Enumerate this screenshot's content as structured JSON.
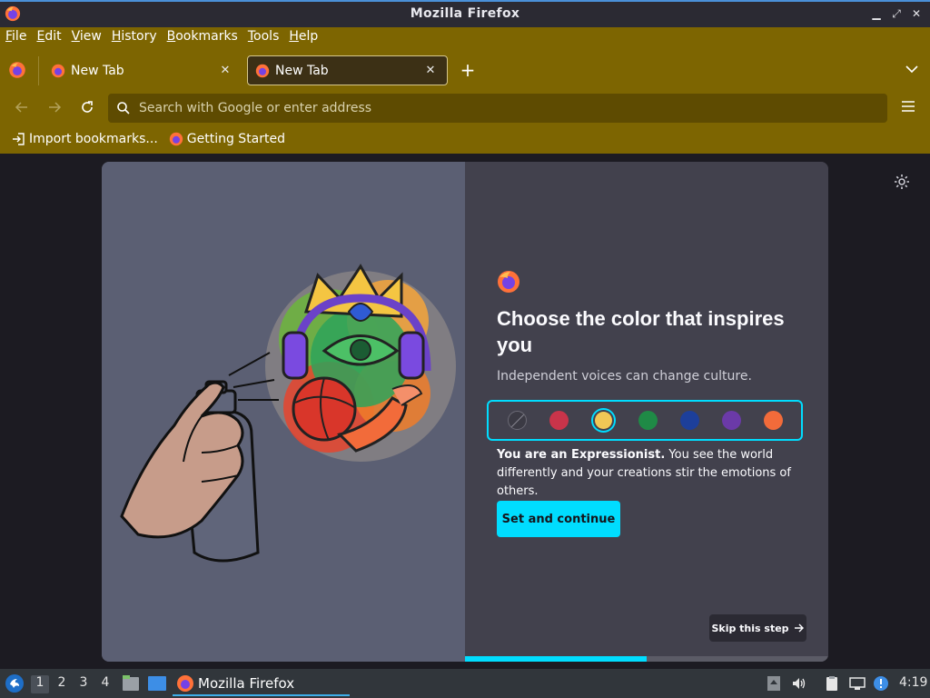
{
  "window": {
    "title": "Mozilla Firefox"
  },
  "menubar": [
    {
      "label": "File",
      "key": "F",
      "rest": "ile"
    },
    {
      "label": "Edit",
      "key": "E",
      "rest": "dit"
    },
    {
      "label": "View",
      "key": "V",
      "rest": "iew"
    },
    {
      "label": "History",
      "key": "H",
      "rest": "istory"
    },
    {
      "label": "Bookmarks",
      "key": "B",
      "rest": "ookmarks"
    },
    {
      "label": "Tools",
      "key": "T",
      "rest": "ools"
    },
    {
      "label": "Help",
      "key": "H",
      "rest": "elp"
    }
  ],
  "tabs": [
    {
      "label": "New Tab",
      "active": false
    },
    {
      "label": "New Tab",
      "active": true
    }
  ],
  "urlbar": {
    "placeholder": "Search with Google or enter address",
    "value": ""
  },
  "bookmarks": [
    {
      "label": "Import bookmarks...",
      "icon": "import-icon"
    },
    {
      "label": "Getting Started",
      "icon": "firefox-icon"
    }
  ],
  "onboarding": {
    "heading": "Choose the color that inspires you",
    "subheading": "Independent voices can change culture.",
    "swatches": [
      {
        "name": "none",
        "color": "#3b3a44",
        "selected": false
      },
      {
        "name": "red",
        "color": "#c9344a",
        "selected": false
      },
      {
        "name": "yellow",
        "color": "#f1c856",
        "selected": true
      },
      {
        "name": "green",
        "color": "#1f8a46",
        "selected": false
      },
      {
        "name": "blue",
        "color": "#1d3f9a",
        "selected": false
      },
      {
        "name": "purple",
        "color": "#6b3aa8",
        "selected": false
      },
      {
        "name": "orange",
        "color": "#f26b3a",
        "selected": false
      }
    ],
    "description_bold": "You are an Expressionist.",
    "description_rest": " You see the world differently and your creations stir the emotions of others.",
    "cta_label": "Set and continue",
    "skip_label": "Skip this step",
    "progress": 0.5
  },
  "taskbar": {
    "workspaces": [
      "1",
      "2",
      "3",
      "4"
    ],
    "active_workspace": "1",
    "task_label": "Mozilla Firefox",
    "clock": "4:19"
  },
  "colors": {
    "chrome": "#7d6501",
    "accent": "#00ddff",
    "card_left": "#5b5f73",
    "card_right": "#42414d"
  }
}
